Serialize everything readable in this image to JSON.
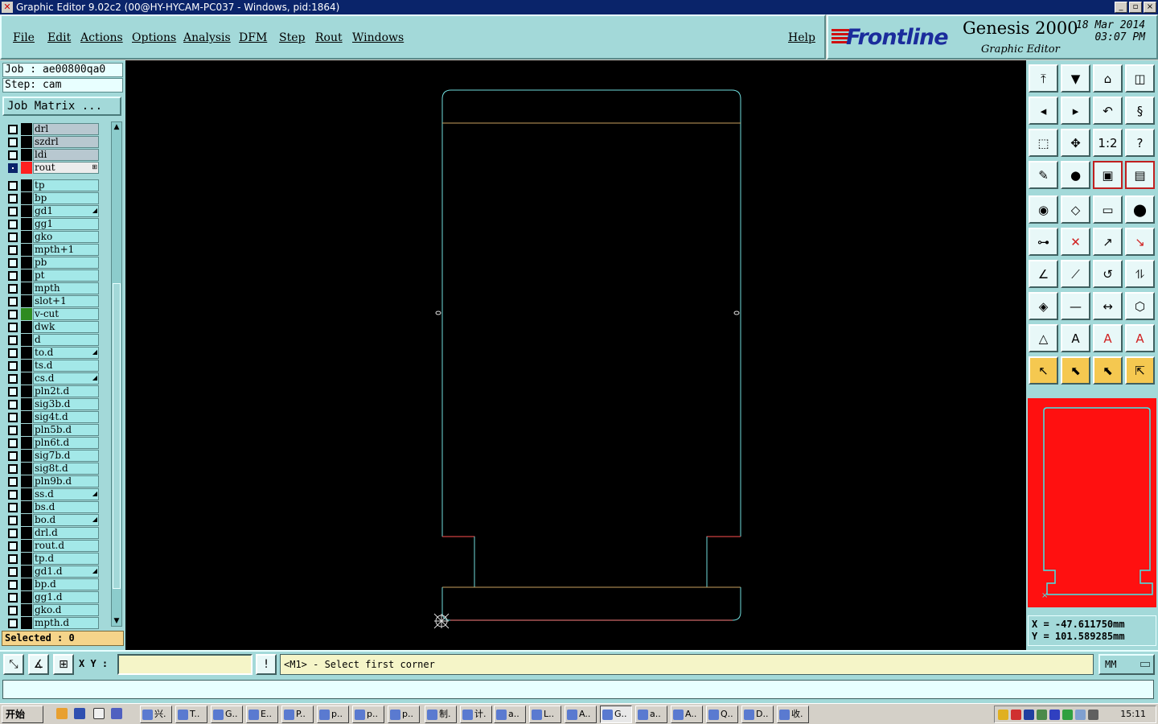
{
  "window": {
    "title": "Graphic Editor 9.02c2 (00@HY-HYCAM-PC037 - Windows, pid:1864)",
    "min": "_",
    "max": "▫",
    "close": "×"
  },
  "menu": {
    "items": [
      "File",
      "Edit",
      "Actions",
      "Options",
      "Analysis",
      "DFM",
      "Step",
      "Rout",
      "Windows"
    ],
    "help": "Help"
  },
  "brand": {
    "logo": "Frontline",
    "product": "Genesis 2000",
    "subtitle": "Graphic Editor",
    "date": "18 Mar 2014",
    "time": "03:07 PM"
  },
  "job": {
    "job": "Job : ae00800qa0",
    "step": "Step: cam",
    "matrix_button": "Job Matrix ..."
  },
  "layers": [
    {
      "name": "drl",
      "style": "gray"
    },
    {
      "name": "szdrl",
      "style": "gray"
    },
    {
      "name": "ldi",
      "style": "gray"
    },
    {
      "name": "rout",
      "style": "active",
      "selected": true,
      "color": "#ff2020",
      "mark": "⊞"
    },
    {
      "name": "tp"
    },
    {
      "name": "bp"
    },
    {
      "name": "gd1",
      "mark": "◢"
    },
    {
      "name": "gg1"
    },
    {
      "name": "gko"
    },
    {
      "name": "mpth+1"
    },
    {
      "name": "pb"
    },
    {
      "name": "pt"
    },
    {
      "name": "mpth"
    },
    {
      "name": "slot+1"
    },
    {
      "name": "v-cut",
      "color": "#2e8b20"
    },
    {
      "name": "dwk"
    },
    {
      "name": "d"
    },
    {
      "name": "to.d",
      "mark": "◢"
    },
    {
      "name": "ts.d"
    },
    {
      "name": "cs.d",
      "mark": "◢"
    },
    {
      "name": "pln2t.d"
    },
    {
      "name": "sig3b.d"
    },
    {
      "name": "sig4t.d"
    },
    {
      "name": "pln5b.d"
    },
    {
      "name": "pln6t.d"
    },
    {
      "name": "sig7b.d"
    },
    {
      "name": "sig8t.d"
    },
    {
      "name": "pln9b.d"
    },
    {
      "name": "ss.d",
      "mark": "◢"
    },
    {
      "name": "bs.d"
    },
    {
      "name": "bo.d",
      "mark": "◢"
    },
    {
      "name": "drl.d"
    },
    {
      "name": "rout.d"
    },
    {
      "name": "tp.d"
    },
    {
      "name": "gd1.d",
      "mark": "◢"
    },
    {
      "name": "bp.d"
    },
    {
      "name": "gg1.d"
    },
    {
      "name": "gko.d"
    },
    {
      "name": "mpth.d"
    }
  ],
  "status": {
    "selected": "Selected : 0"
  },
  "coords": {
    "x": "X = -47.611750mm",
    "y": "Y = 101.589285mm"
  },
  "bottom": {
    "xy_label": "X Y :",
    "prompt": "<M1> - Select first corner",
    "units": "MM",
    "exclaim": "!"
  },
  "toolbar": {
    "icons": [
      "zoom-home-icon",
      "save-icon",
      "home-icon",
      "window-split-icon",
      "pan-left-icon",
      "pan-right-icon",
      "undo-icon",
      "snap-icon",
      "zoom-fit-icon",
      "zoom-center-icon",
      "scale-1-2-icon",
      "help-icon",
      "tools-icon",
      "probe-icon",
      "layer-compare-icon",
      "layer-stack-icon",
      "pad-icon",
      "polygon-icon",
      "ruler-icon",
      "circle-icon",
      "connect-icon",
      "cross-icon",
      "line-point-icon",
      "line-point-red-icon",
      "angle-icon",
      "slash-icon",
      "arc-icon",
      "mirror-icon",
      "feature-icon",
      "line-icon",
      "measure-icon",
      "shapes-icon",
      "triangle-icon",
      "font-a-icon",
      "font-a-red-icon",
      "font-a-cross-icon",
      "pointer-icon",
      "select-icon",
      "select-box-icon",
      "route-icon"
    ],
    "glyphs": [
      "⤒",
      "▼",
      "⌂",
      "◫",
      "◂",
      "▸",
      "↶",
      "§",
      "⬚",
      "✥",
      "1:2",
      "?",
      "✎",
      "●",
      "▣",
      "▤",
      "◉",
      "◇",
      "▭",
      "⬤",
      "⊶",
      "✕",
      "↗",
      "↘",
      "∠",
      "⟋",
      "↺",
      "⥮",
      "◈",
      "—",
      "↔",
      "⬡",
      "△",
      "A",
      "A",
      "A",
      "↖",
      "⬉",
      "⬉",
      "⇱"
    ]
  },
  "taskbar": {
    "start": "开始",
    "items": [
      "兴.",
      "T..",
      "G..",
      "E..",
      "P..",
      "p..",
      "p..",
      "p..",
      "制.",
      "计.",
      "a..",
      "L..",
      "A..",
      "G..",
      "a..",
      "A..",
      "Q..",
      "D..",
      "收."
    ],
    "active_index": 13,
    "clock": "15:11"
  }
}
